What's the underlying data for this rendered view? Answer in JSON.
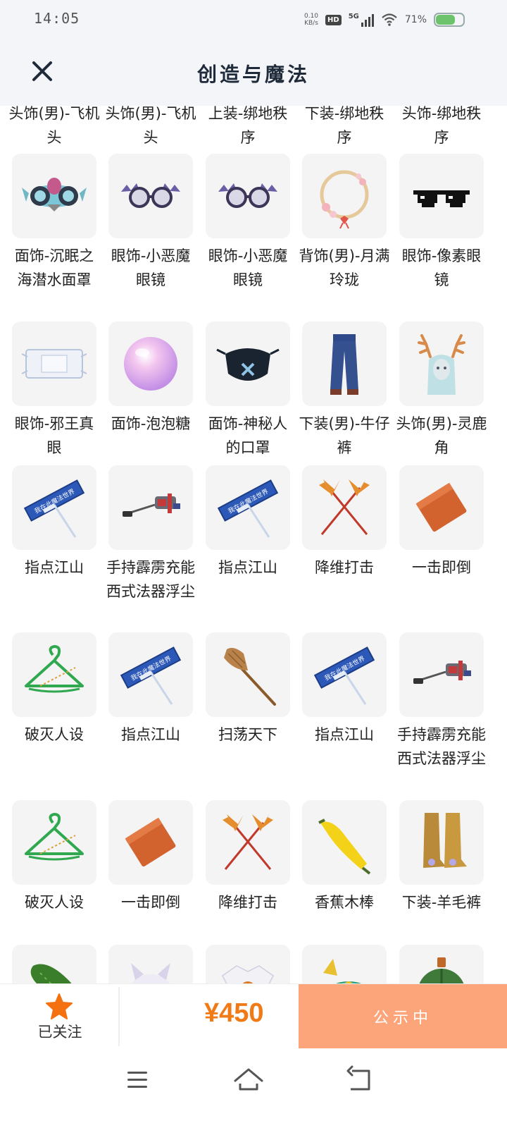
{
  "status_bar": {
    "time": "14:05",
    "net_speed_value": "0.10",
    "net_speed_unit": "KB/s",
    "hd": "HD",
    "network": "5G",
    "battery_percent": "71%",
    "battery_level": 0.71
  },
  "header": {
    "title": "创造与魔法"
  },
  "items": [
    {
      "label": "头饰(男)-飞机头",
      "icon": "partial-item"
    },
    {
      "label": "头饰(男)-飞机头",
      "icon": "partial-item"
    },
    {
      "label": "上装-绑地秩序",
      "icon": "partial-item"
    },
    {
      "label": "下装-绑地秩序",
      "icon": "partial-item"
    },
    {
      "label": "头饰-绑地秩序",
      "icon": "partial-item"
    },
    {
      "label": "面饰-沉眠之海潜水面罩",
      "icon": "diving-mask-icon"
    },
    {
      "label": "眼饰-小恶魔眼镜",
      "icon": "devil-glasses-icon"
    },
    {
      "label": "眼饰-小恶魔眼镜",
      "icon": "devil-glasses-icon"
    },
    {
      "label": "背饰(男)-月满玲珑",
      "icon": "floral-ring-icon"
    },
    {
      "label": "眼饰-像素眼镜",
      "icon": "pixel-glasses-icon"
    },
    {
      "label": "眼饰-邪王真眼",
      "icon": "eye-bandage-icon"
    },
    {
      "label": "面饰-泡泡糖",
      "icon": "bubble-gum-icon"
    },
    {
      "label": "面饰-神秘人的口罩",
      "icon": "face-mask-icon"
    },
    {
      "label": "下装(男)-牛仔裤",
      "icon": "jeans-icon"
    },
    {
      "label": "头饰(男)-灵鹿角",
      "icon": "deer-antler-icon"
    },
    {
      "label": "指点江山",
      "icon": "sign-pointer-icon"
    },
    {
      "label": "手持霹雳充能西式法器浮尘",
      "icon": "vacuum-cleaner-icon"
    },
    {
      "label": "指点江山",
      "icon": "sign-pointer-icon"
    },
    {
      "label": "降维打击",
      "icon": "crossed-brushes-icon"
    },
    {
      "label": "一击即倒",
      "icon": "brick-icon"
    },
    {
      "label": "破灭人设",
      "icon": "hanger-icon"
    },
    {
      "label": "指点江山",
      "icon": "sign-pointer-icon"
    },
    {
      "label": "扫荡天下",
      "icon": "broom-icon"
    },
    {
      "label": "指点江山",
      "icon": "sign-pointer-icon"
    },
    {
      "label": "手持霹雳充能西式法器浮尘",
      "icon": "vacuum-cleaner-icon"
    },
    {
      "label": "破灭人设",
      "icon": "hanger-icon"
    },
    {
      "label": "一击即倒",
      "icon": "brick-icon"
    },
    {
      "label": "降维打击",
      "icon": "crossed-brushes-icon"
    },
    {
      "label": "香蕉木棒",
      "icon": "banana-icon"
    },
    {
      "label": "下装-羊毛裤",
      "icon": "boots-icon"
    },
    {
      "label": "",
      "icon": "cucumber-icon"
    },
    {
      "label": "",
      "icon": "cat-plush-icon"
    },
    {
      "label": "",
      "icon": "jacket-icon"
    },
    {
      "label": "",
      "icon": "feather-hat-icon"
    },
    {
      "label": "",
      "icon": "green-orb-icon"
    }
  ],
  "sign_text": "我在此魔法世界",
  "bottom_bar": {
    "follow_label": "已关注",
    "price": "¥450",
    "cta_label": "公示中"
  },
  "colors": {
    "accent": "#f07a16",
    "cta_bg": "#fca57b",
    "header_bg": "#f3f5f9",
    "star": "#f5700e"
  }
}
